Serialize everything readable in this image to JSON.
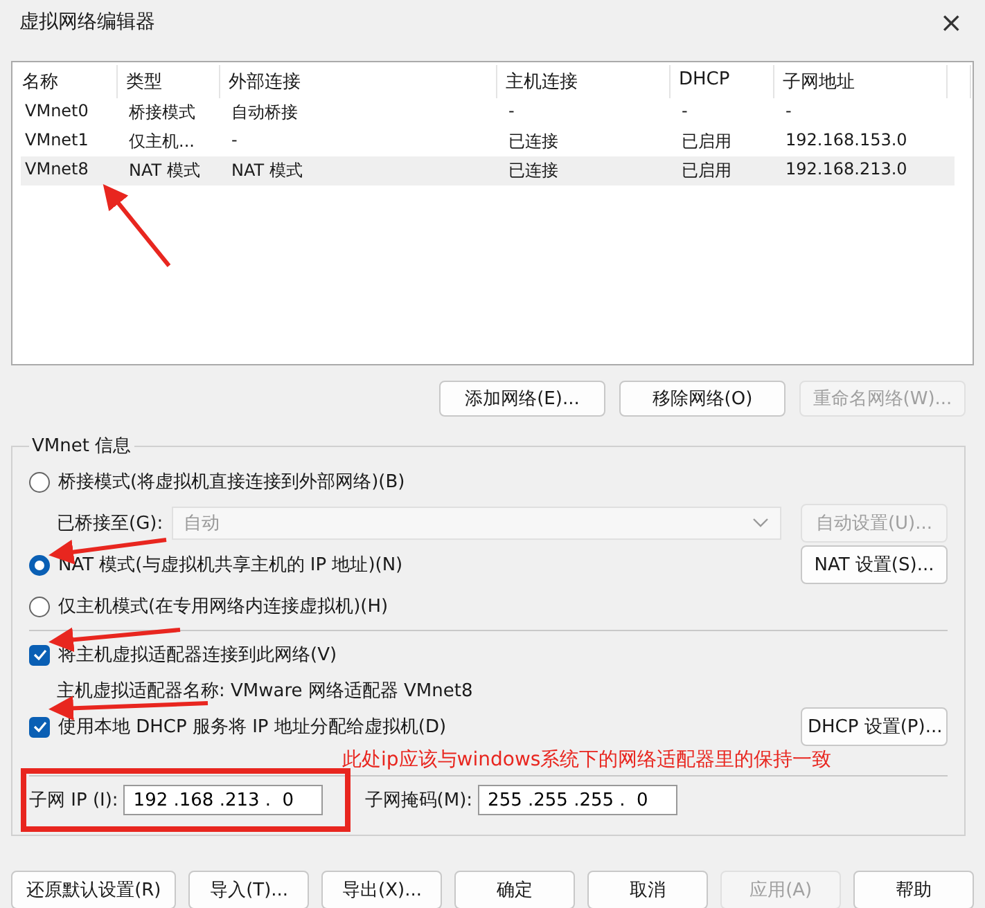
{
  "window": {
    "title": "虚拟网络编辑器",
    "close": "×"
  },
  "table": {
    "columns": [
      "名称",
      "类型",
      "外部连接",
      "主机连接",
      "DHCP",
      "子网地址"
    ],
    "rows": [
      {
        "cells": [
          "VMnet0",
          "桥接模式",
          "自动桥接",
          "-",
          "-",
          "-"
        ],
        "selected": false
      },
      {
        "cells": [
          "VMnet1",
          "仅主机...",
          "-",
          "已连接",
          "已启用",
          "192.168.153.0"
        ],
        "selected": false
      },
      {
        "cells": [
          "VMnet8",
          "NAT 模式",
          "NAT 模式",
          "已连接",
          "已启用",
          "192.168.213.0"
        ],
        "selected": true
      }
    ]
  },
  "network_buttons": [
    {
      "label": "添加网络(E)...",
      "disabled": false
    },
    {
      "label": "移除网络(O)",
      "disabled": false
    },
    {
      "label": "重命名网络(W)...",
      "disabled": true
    }
  ],
  "vmnet_info": {
    "title": "VMnet 信息",
    "modes": [
      {
        "kind": "bridged",
        "label": "桥接模式(将虚拟机直接连接到外部网络)(B)",
        "selected": false,
        "bridged_to": {
          "label": "已桥接至(G):",
          "value": "自动",
          "disabled": true
        },
        "button": {
          "label": "自动设置(U)...",
          "disabled": true
        }
      },
      {
        "kind": "nat",
        "label": "NAT 模式(与虚拟机共享主机的 IP 地址)(N)",
        "selected": true,
        "button": {
          "label": "NAT 设置(S)...",
          "disabled": false
        }
      },
      {
        "kind": "hostonly",
        "label": "仅主机模式(在专用网络内连接虚拟机)(H)",
        "selected": false
      }
    ],
    "connect_adapter": {
      "label": "将主机虚拟适配器连接到此网络(V)",
      "checked": true,
      "adapter_name": "主机虚拟适配器名称: VMware 网络适配器 VMnet8"
    },
    "dhcp": {
      "label": "使用本地 DHCP 服务将 IP 地址分配给虚拟机(D)",
      "checked": true,
      "button": {
        "label": "DHCP 设置(P)...",
        "disabled": false
      }
    },
    "subnet_ip": {
      "label": "子网 IP (I):",
      "value": "192 .168 .213 .  0"
    },
    "subnet_mask": {
      "label": "子网掩码(M):",
      "value": "255 .255 .255 .  0"
    }
  },
  "footer_buttons": [
    {
      "label": "还原默认设置(R)",
      "disabled": false
    },
    {
      "label": "导入(T)...",
      "disabled": false
    },
    {
      "label": "导出(X)...",
      "disabled": false
    },
    {
      "label": "确定",
      "disabled": false
    },
    {
      "label": "取消",
      "disabled": false
    },
    {
      "label": "应用(A)",
      "disabled": true
    },
    {
      "label": "帮助",
      "disabled": false
    }
  ],
  "annotation": {
    "note": "此处ip应该与windows系统下的网络适配器里的保持一致"
  }
}
